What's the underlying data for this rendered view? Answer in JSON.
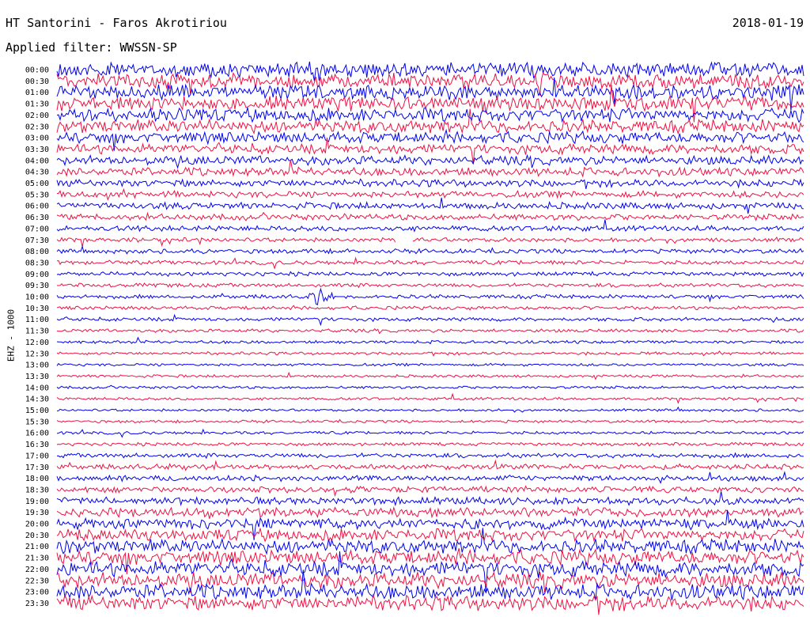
{
  "header": {
    "station": "HT Santorini - Faros Akrotiriou",
    "date": "2018-01-19",
    "filter": "Applied filter: WWSSN-SP"
  },
  "chart_data": {
    "type": "line",
    "title": "HT Santorini - Faros Akrotiriou",
    "ylabel": "EHZ - 1000",
    "grid": false,
    "legend": "none",
    "row_labels": [
      "00:00",
      "00:30",
      "01:00",
      "01:30",
      "02:00",
      "02:30",
      "03:00",
      "03:30",
      "04:00",
      "04:30",
      "05:00",
      "05:30",
      "06:00",
      "06:30",
      "07:00",
      "07:30",
      "08:00",
      "08:30",
      "09:00",
      "09:30",
      "10:00",
      "10:30",
      "11:00",
      "11:30",
      "12:00",
      "12:30",
      "13:00",
      "13:30",
      "14:00",
      "14:30",
      "15:00",
      "15:30",
      "16:00",
      "16:30",
      "17:00",
      "17:30",
      "18:00",
      "18:30",
      "19:00",
      "19:30",
      "20:00",
      "20:30",
      "21:00",
      "21:30",
      "22:00",
      "22:30",
      "23:00",
      "23:30"
    ],
    "colors": [
      "#0000ee",
      "#ee1144"
    ],
    "noise_level": [
      1.0,
      1.0,
      1.0,
      0.95,
      0.9,
      0.85,
      0.75,
      0.65,
      0.6,
      0.55,
      0.5,
      0.45,
      0.45,
      0.4,
      0.35,
      0.3,
      0.3,
      0.28,
      0.28,
      0.26,
      0.26,
      0.24,
      0.24,
      0.22,
      0.2,
      0.2,
      0.18,
      0.18,
      0.18,
      0.18,
      0.18,
      0.18,
      0.2,
      0.22,
      0.3,
      0.35,
      0.38,
      0.42,
      0.5,
      0.62,
      0.72,
      0.82,
      0.9,
      0.95,
      1.0,
      1.0,
      1.0,
      1.0
    ],
    "events": [
      {
        "row": "10:00",
        "time_min": 10.0,
        "duration_min": 1.6,
        "amplitude": 3.2
      },
      {
        "row": "07:30",
        "gap_start_min": 13.6,
        "gap_end_min": 14.3
      }
    ]
  }
}
